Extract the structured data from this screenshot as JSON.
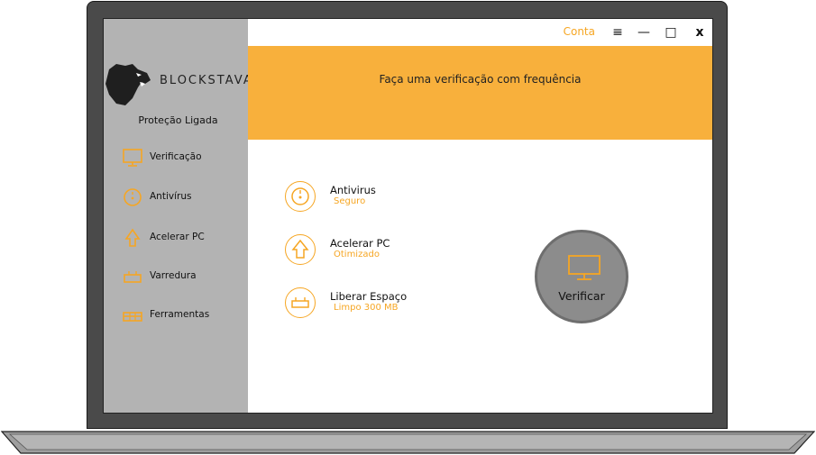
{
  "app": {
    "brand": "BLOCKSTAVA",
    "status": "Proteção Ligada"
  },
  "titlebar": {
    "account_label": "Conta",
    "menu_symbol": "≡",
    "minimize_symbol": "—",
    "maximize_symbol": "□",
    "close_symbol": "x"
  },
  "banner": {
    "message": "Faça uma verificação com frequência"
  },
  "sidebar": {
    "items": [
      {
        "label": "Verificação",
        "icon": "monitor-icon"
      },
      {
        "label": "Antivírus",
        "icon": "shield-circle-icon"
      },
      {
        "label": "Acelerar PC",
        "icon": "rocket-icon"
      },
      {
        "label": "Varredura",
        "icon": "broom-icon"
      },
      {
        "label": "Ferramentas",
        "icon": "toolbox-icon"
      }
    ]
  },
  "features": [
    {
      "name": "Antivirus",
      "status": "Seguro",
      "icon": "shield-circle-icon"
    },
    {
      "name": "Acelerar PC",
      "status": "Otimizado",
      "icon": "rocket-icon"
    },
    {
      "name": "Liberar Espaço",
      "status": "Limpo 300 MB",
      "icon": "broom-icon"
    }
  ],
  "action": {
    "verify_label": "Verificar",
    "icon": "monitor-icon"
  },
  "colors": {
    "accent": "#f8b03c",
    "accent_text": "#f6a623",
    "sidebar": "#b3b3b3",
    "frame": "#4a4a4a",
    "button": "#8c8c8c"
  }
}
